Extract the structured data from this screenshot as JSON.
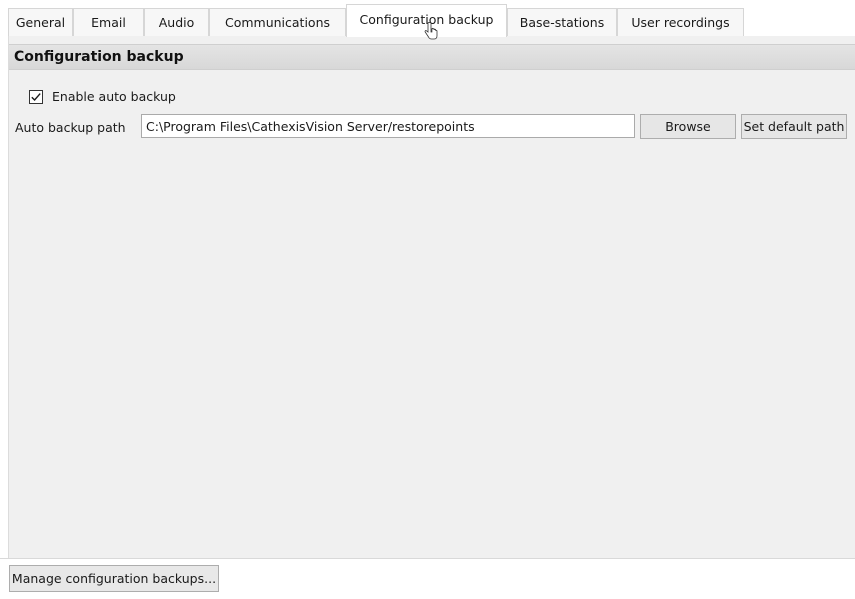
{
  "tabs": [
    {
      "label": "General",
      "active": false
    },
    {
      "label": "Email",
      "active": false
    },
    {
      "label": "Audio",
      "active": false
    },
    {
      "label": "Communications",
      "active": false
    },
    {
      "label": "Configuration backup",
      "active": true
    },
    {
      "label": "Base-stations",
      "active": false
    },
    {
      "label": "User recordings",
      "active": false
    }
  ],
  "section": {
    "title": "Configuration backup"
  },
  "auto_backup": {
    "checkbox_label": "Enable auto backup",
    "checked": true,
    "path_label": "Auto backup path",
    "path_value": "C:\\Program Files\\CathexisVision Server/restorepoints",
    "browse_label": "Browse",
    "set_default_label": "Set default path"
  },
  "footer": {
    "manage_label": "Manage configuration backups..."
  },
  "icons": {
    "checkbox_check": "check-icon",
    "cursor": "hand-pointer-icon"
  },
  "colors": {
    "panel_bg": "#f0f0f0",
    "header_bg": "#dcdcdc",
    "button_bg": "#e6e6e6"
  }
}
